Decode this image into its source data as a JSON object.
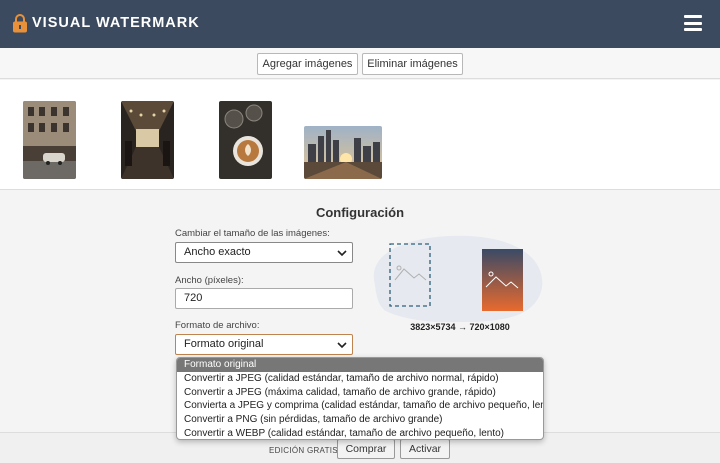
{
  "header": {
    "brand": "VISUAL WATERMARK",
    "logo_icon": "lock-icon",
    "menu_icon": "hamburger-menu-icon",
    "bg_color": "#3b4a5e"
  },
  "toolbar": {
    "add_images": "Agregar imágenes",
    "remove_images": "Eliminar imágenes"
  },
  "thumbnails": [
    {
      "name": "street-building-photo"
    },
    {
      "name": "cafe-interior-photo"
    },
    {
      "name": "coffee-cup-photo"
    },
    {
      "name": "city-sunset-photo"
    }
  ],
  "config": {
    "title": "Configuración",
    "resize_label": "Cambiar el tamaño de las imágenes:",
    "resize_value": "Ancho exacto",
    "width_label": "Ancho (píxeles):",
    "width_value": "720",
    "format_label": "Formato de archivo:",
    "format_value": "Formato original",
    "dimensions": "3823×5734 → 720×1080"
  },
  "format_options": [
    "Formato original",
    "Convertir a JPEG (calidad estándar, tamaño de archivo normal, rápido)",
    "Convertir a JPEG (máxima calidad, tamaño de archivo grande, rápido)",
    "Convierta a JPEG y comprima (calidad estándar, tamaño de archivo pequeño, lento)",
    "Convertir a PNG (sin pérdidas, tamaño de archivo grande)",
    "Convertir a WEBP (calidad estándar, tamaño de archivo pequeño, lento)"
  ],
  "footer": {
    "edition": "EDICIÓN GRATIS",
    "buy": "Comprar",
    "activate": "Activar"
  }
}
